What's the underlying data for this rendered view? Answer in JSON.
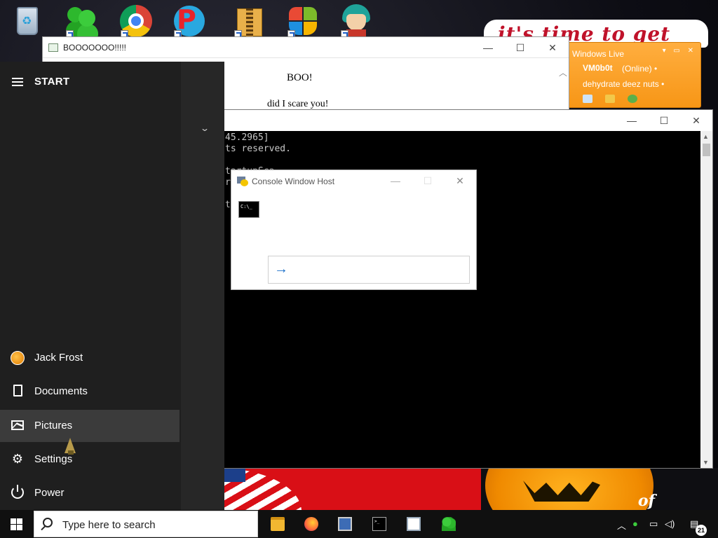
{
  "wallpaper": {
    "banner_text": "it's time to get shit",
    "pumpkin_text": "of"
  },
  "desktop_icons": [
    {
      "name": "recycle-bin-icon"
    },
    {
      "name": "messenger-icon"
    },
    {
      "name": "chrome-icon"
    },
    {
      "name": "p-game-icon"
    },
    {
      "name": "zip-folder-icon"
    },
    {
      "name": "windows-shield-icon"
    },
    {
      "name": "anime-character-icon"
    }
  ],
  "windows_live": {
    "title": "Windows Live",
    "username": "VM0b0t",
    "status": "(Online) •",
    "message": "dehydrate deez nuts •"
  },
  "boo_window": {
    "title": "BOOOOOOO!!!!!",
    "heading": "BOO!",
    "line": "did I scare you!"
  },
  "console": {
    "line1": "45.2965]",
    "line2": "ts reserved.",
    "line3": "",
    "line4": "tartupSca",
    "line5": "r",
    "line6": "",
    "line7": "t"
  },
  "console_host": {
    "title": "Console Window Host",
    "cmd_icon_text": "C:\\_"
  },
  "start_menu": {
    "header": "START",
    "items": [
      {
        "label": "Jack Frost",
        "icon": "user-avatar"
      },
      {
        "label": "Documents",
        "icon": "document-icon"
      },
      {
        "label": "Pictures",
        "icon": "pictures-icon"
      },
      {
        "label": "Settings",
        "icon": "gear-icon"
      },
      {
        "label": "Power",
        "icon": "power-icon"
      }
    ]
  },
  "taskbar": {
    "search_placeholder": "Type here to search",
    "apps": [
      "file-explorer-icon",
      "firefox-icon",
      "monitor-app-icon",
      "cmd-icon",
      "window-app-icon",
      "messenger-icon"
    ],
    "notification_count": "21"
  }
}
